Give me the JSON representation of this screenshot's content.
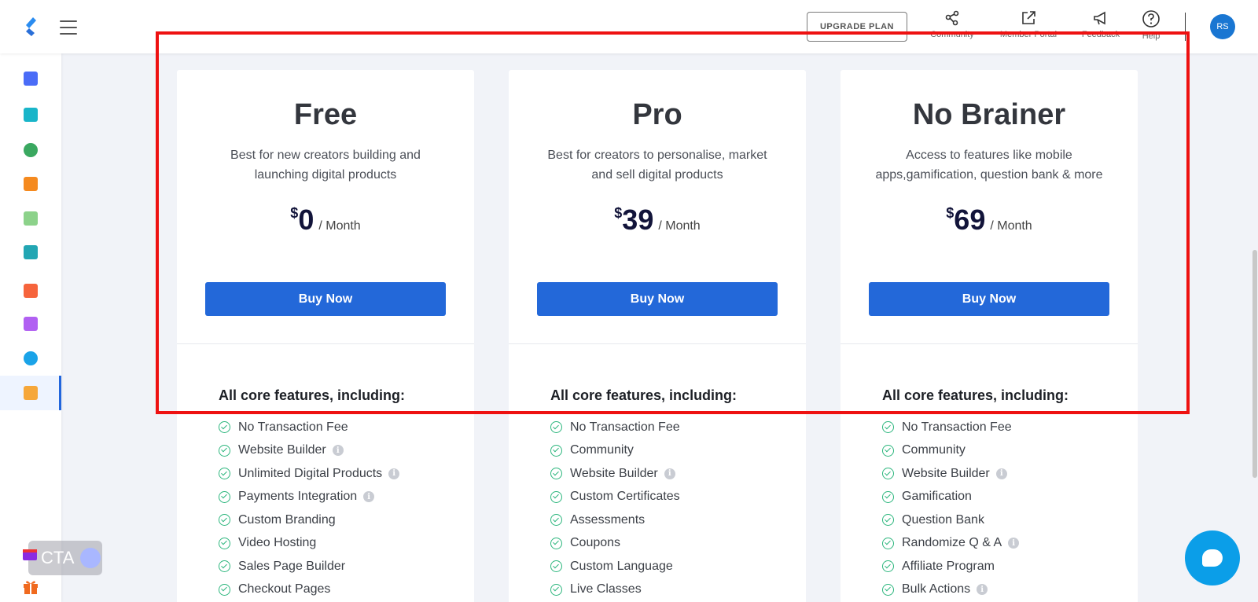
{
  "header": {
    "upgrade_label": "UPGRADE PLAN",
    "links": [
      {
        "label": "Community",
        "icon": "community-icon"
      },
      {
        "label": "Member Portal",
        "icon": "external-link-icon"
      },
      {
        "label": "Feedback",
        "icon": "megaphone-icon"
      },
      {
        "label": "Help",
        "icon": "help-icon"
      }
    ],
    "avatar_initials": "RS"
  },
  "sidebar": {
    "items": [
      {
        "icon": "dashboard-icon",
        "color": "#4a6cf7"
      },
      {
        "icon": "users-icon",
        "color": "#19b5c9"
      },
      {
        "icon": "globe-icon",
        "color": "#3aa860"
      },
      {
        "icon": "book-icon",
        "color": "#f58a1f"
      },
      {
        "icon": "puzzle-icon",
        "color": "#8cd28a"
      },
      {
        "icon": "analytics-icon",
        "color": "#22a6b3"
      },
      {
        "icon": "star-icon",
        "color": "#f6643c"
      },
      {
        "icon": "settings-icon",
        "color": "#b160f2"
      },
      {
        "icon": "pie-chart-icon",
        "color": "#1aa3e8"
      },
      {
        "icon": "apps-icon",
        "color": "#f6a73a"
      }
    ]
  },
  "cta_widget": {
    "label": "CTA"
  },
  "plans": [
    {
      "name": "Free",
      "description": "Best for new creators building and launching digital products",
      "currency": "$",
      "price": "0",
      "period": "/ Month",
      "button": "Buy Now",
      "features_heading": "All core features, including:",
      "features": [
        {
          "label": "No Transaction Fee",
          "info": false
        },
        {
          "label": "Website Builder",
          "info": true
        },
        {
          "label": "Unlimited Digital Products",
          "info": true
        },
        {
          "label": "Payments Integration",
          "info": true
        },
        {
          "label": "Custom Branding",
          "info": false
        },
        {
          "label": "Video Hosting",
          "info": false
        },
        {
          "label": "Sales Page Builder",
          "info": false
        },
        {
          "label": "Checkout Pages",
          "info": false
        }
      ]
    },
    {
      "name": "Pro",
      "description": "Best for creators to personalise, market and sell digital products",
      "currency": "$",
      "price": "39",
      "period": "/ Month",
      "button": "Buy Now",
      "features_heading": "All core features, including:",
      "features": [
        {
          "label": "No Transaction Fee",
          "info": false
        },
        {
          "label": "Community",
          "info": false
        },
        {
          "label": "Website Builder",
          "info": true
        },
        {
          "label": "Custom Certificates",
          "info": false
        },
        {
          "label": "Assessments",
          "info": false
        },
        {
          "label": "Coupons",
          "info": false
        },
        {
          "label": "Custom Language",
          "info": false
        },
        {
          "label": "Live Classes",
          "info": false
        }
      ]
    },
    {
      "name": "No Brainer",
      "description": "Access to features like mobile apps,gamification, question bank & more",
      "currency": "$",
      "price": "69",
      "period": "/ Month",
      "button": "Buy Now",
      "features_heading": "All core features, including:",
      "features": [
        {
          "label": "No Transaction Fee",
          "info": false
        },
        {
          "label": "Community",
          "info": false
        },
        {
          "label": "Website Builder",
          "info": true
        },
        {
          "label": "Gamification",
          "info": false
        },
        {
          "label": "Question Bank",
          "info": false
        },
        {
          "label": "Randomize Q & A",
          "info": true
        },
        {
          "label": "Affiliate Program",
          "info": false
        },
        {
          "label": "Bulk Actions",
          "info": true
        }
      ]
    }
  ],
  "colors": {
    "primary_button": "#2368d9",
    "check": "#2cb67d",
    "annotation": "#ee1111",
    "chat": "#0b9ee8"
  }
}
